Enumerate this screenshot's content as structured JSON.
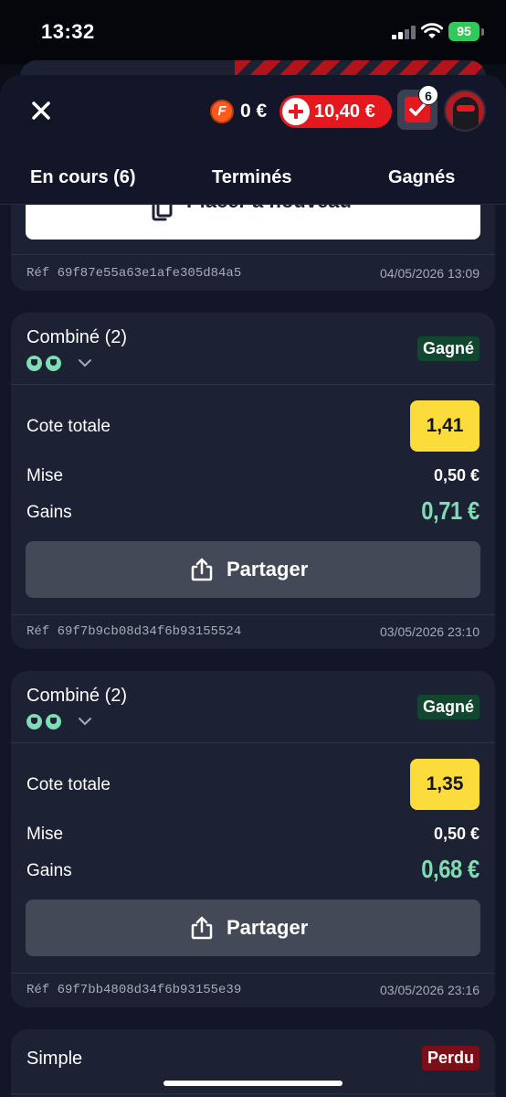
{
  "status_bar": {
    "time": "13:32",
    "battery": "95"
  },
  "header": {
    "freebet_icon": "F",
    "freebet_amount": "0 €",
    "balance": "10,40 €",
    "bets_count": "6"
  },
  "tabs": [
    {
      "label": "En cours (6)"
    },
    {
      "label": "Terminés"
    },
    {
      "label": "Gagnés"
    }
  ],
  "partial_card": {
    "button": "Placer à nouveau",
    "ref": "Réf 69f87e55a63e1afe305d84a5",
    "date": "04/05/2026 13:09"
  },
  "bets": [
    {
      "type": "Combiné (2)",
      "status": "Gagné",
      "odds_label": "Cote totale",
      "odds": "1,41",
      "stake_label": "Mise",
      "stake": "0,50 €",
      "gains_label": "Gains",
      "gains": "0,71 €",
      "share": "Partager",
      "ref": "Réf 69f7b9cb08d34f6b93155524",
      "date": "03/05/2026 23:10"
    },
    {
      "type": "Combiné (2)",
      "status": "Gagné",
      "odds_label": "Cote totale",
      "odds": "1,35",
      "stake_label": "Mise",
      "stake": "0,50 €",
      "gains_label": "Gains",
      "gains": "0,68 €",
      "share": "Partager",
      "ref": "Réf 69f7bb4808d34f6b93155e39",
      "date": "03/05/2026 23:16"
    },
    {
      "type": "Simple",
      "status": "Perdu"
    }
  ],
  "colors": {
    "accent_red": "#e3191f",
    "won_green": "#7fdcb3",
    "odds_yellow": "#fbdc3a",
    "background": "#121628"
  }
}
